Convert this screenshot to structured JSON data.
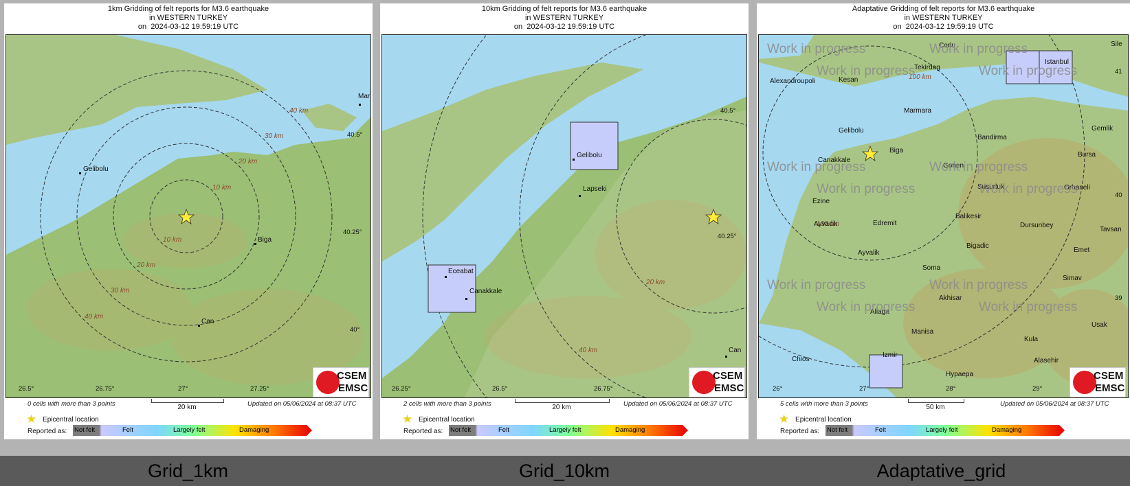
{
  "colors": {
    "water": "#a6d8f0",
    "land": "#9bbf74",
    "star": "#ffee33"
  },
  "panels": [
    {
      "title": [
        "1km Gridding of felt reports for M3.6 earthquake",
        "in WESTERN TURKEY",
        "on  2024-03-12 19:59:19 UTC"
      ],
      "places": [
        "Gelibolu",
        "Biga",
        "Can",
        "Mar"
      ],
      "distances": [
        "40 km",
        "30 km",
        "20 km",
        "10 km",
        "10 km",
        "20 km",
        "30 km",
        "40 km"
      ],
      "ticks": [
        "40.5°",
        "40.25°",
        "40°",
        "26.5°",
        "26.75°",
        "27°",
        "27.25°"
      ],
      "cells_note": "0 cells with more than 3 points",
      "scale": "20 km",
      "updated": "Updated on 05/06/2024 at 08:37 UTC",
      "caption": "Grid_1km"
    },
    {
      "title": [
        "10km Gridding of felt reports for M3.6 earthquake",
        "in WESTERN TURKEY",
        "on  2024-03-12 19:59:19 UTC"
      ],
      "places": [
        "Gelibolu",
        "Lapseki",
        "Eceabat",
        "Canakkale",
        "Can"
      ],
      "distances": [
        "20 km",
        "40 km"
      ],
      "ticks": [
        "40.5°",
        "40.25°",
        "26.25°",
        "26.5°",
        "26.75°"
      ],
      "cells_note": "2 cells with more than 3 points",
      "scale": "20 km",
      "updated": "Updated on 05/06/2024 at 08:37 UTC",
      "caption": "Grid_10km"
    },
    {
      "title": [
        "Adaptative Gridding of felt reports for M3.6 earthquake",
        "in WESTERN TURKEY",
        "on  2024-03-12 19:59:19 UTC"
      ],
      "places": [
        "Corlu",
        "Istanbul",
        "Sile",
        "Tekirdag",
        "Kesan",
        "Alexandroupoli",
        "Marmara",
        "Gelibolu",
        "Bandirma",
        "Gemlik",
        "Biga",
        "Canakkale",
        "Gonen",
        "Bursa",
        "Susurluk",
        "Orhaneli",
        "Ezine",
        "Edremit",
        "Balikesir",
        "Dursunbey",
        "Tavsan",
        "Ayvacik",
        "Bigadic",
        "Ayvalik",
        "Emet",
        "Soma",
        "Simav",
        "Akhisar",
        "Aliaga",
        "Manisa",
        "Usak",
        "Kula",
        "Izmir",
        "Alasehir",
        "Chios",
        "Hypaepa"
      ],
      "distances": [
        "100 km",
        "100 km"
      ],
      "ticks": [
        "41",
        "40",
        "39",
        "26°",
        "27°",
        "28°",
        "29°"
      ],
      "watermark": "Work in progress",
      "cells_note": "5 cells with more than 3 points",
      "scale": "50 km",
      "updated": "Updated on 05/06/2024 at 08:37 UTC",
      "caption": "Adaptative_grid"
    }
  ],
  "legend": {
    "epicenter": "Epicentral location",
    "reported_as": "Reported as:",
    "levels": [
      "Not felt",
      "Felt",
      "Largely felt",
      "Damaging"
    ]
  },
  "logo": {
    "line1": "CSEM",
    "line2": "EMSC"
  }
}
